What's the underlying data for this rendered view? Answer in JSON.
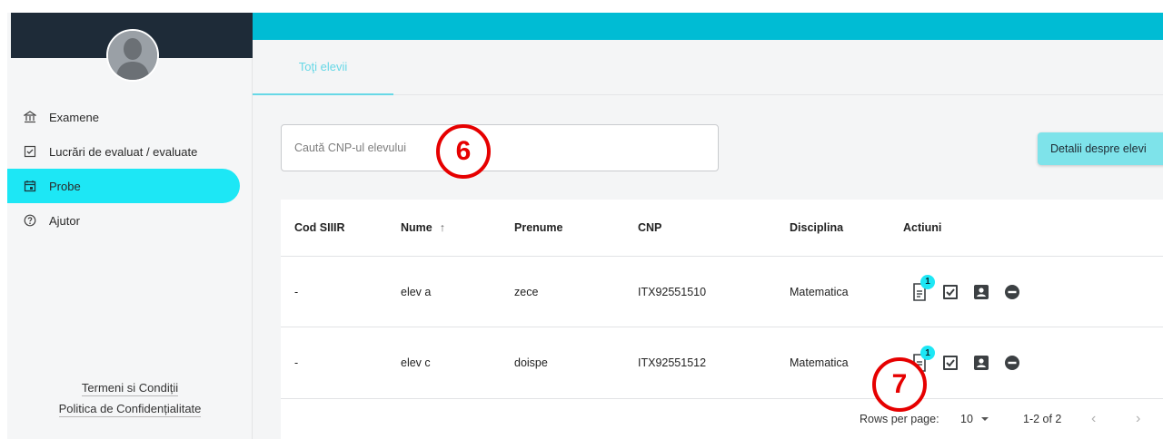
{
  "sidebar": {
    "items": [
      {
        "label": "Examene",
        "icon": "bank-icon"
      },
      {
        "label": "Lucrări de evaluat / evaluate",
        "icon": "checkbox-icon"
      },
      {
        "label": "Probe",
        "icon": "calendar-icon"
      },
      {
        "label": "Ajutor",
        "icon": "help-circle-icon"
      }
    ],
    "active_item": "Probe",
    "terms_link": "Termeni si Condiții",
    "privacy_link": "Politica de Confidențialitate"
  },
  "tabs": [
    {
      "label": "Toţi elevii",
      "active": true
    }
  ],
  "search": {
    "placeholder": "Caută CNP-ul elevului"
  },
  "toolbar": {
    "details_label": "Detalii despre elevi"
  },
  "table": {
    "columns": [
      "Cod SIIIR",
      "Nume",
      "Prenume",
      "CNP",
      "Disciplina",
      "Actiuni"
    ],
    "sort_column": "Nume",
    "sort_direction": "asc",
    "sort_indicator": "↑",
    "rows": [
      {
        "cod": "-",
        "nume": "elev a",
        "prenume": "zece",
        "cnp": "ITX92551510",
        "disciplina": "Matematica",
        "badge": "1"
      },
      {
        "cod": "-",
        "nume": "elev c",
        "prenume": "doispe",
        "cnp": "ITX92551512",
        "disciplina": "Matematica",
        "badge": "1"
      }
    ]
  },
  "pagination": {
    "rows_per_page_label": "Rows per page:",
    "rows_per_page": "10",
    "range": "1-2 of 2",
    "prev": "‹",
    "next": "›"
  },
  "markers": {
    "step6": "6",
    "step7": "7"
  },
  "colors": {
    "accent": "#00bcd4",
    "active_nav": "#1de7f5",
    "tab_text": "#67d8e6",
    "button": "#7ee3ea",
    "marker": "#e60000",
    "sidebar_head": "#1e2b38"
  }
}
